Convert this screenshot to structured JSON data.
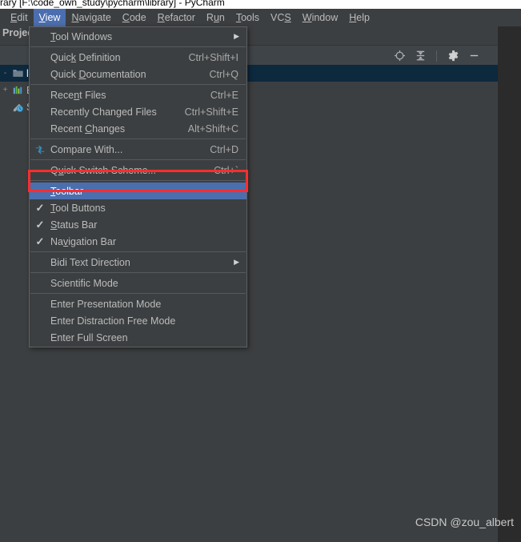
{
  "window": {
    "title": "rary [F:\\code_own_study\\pycharm\\library] - PyCharm"
  },
  "menubar": {
    "items": [
      {
        "label": "Edit",
        "mnemonic": "E",
        "selected": false
      },
      {
        "label": "View",
        "mnemonic": "V",
        "selected": true
      },
      {
        "label": "Navigate",
        "mnemonic": "N",
        "selected": false
      },
      {
        "label": "Code",
        "mnemonic": "C",
        "selected": false
      },
      {
        "label": "Refactor",
        "mnemonic": "R",
        "selected": false
      },
      {
        "label": "Run",
        "mnemonic": "u",
        "selected": false
      },
      {
        "label": "Tools",
        "mnemonic": "T",
        "selected": false
      },
      {
        "label": "VCS",
        "mnemonic": "S",
        "selected": false
      },
      {
        "label": "Window",
        "mnemonic": "W",
        "selected": false
      },
      {
        "label": "Help",
        "mnemonic": "H",
        "selected": false
      }
    ]
  },
  "project_panel": {
    "title": "Project",
    "toolbar": {
      "buttons": [
        {
          "icon": "locate-target-icon",
          "name": "select-opened-file-button"
        },
        {
          "icon": "collapse-all-icon",
          "name": "collapse-all-button"
        },
        {
          "icon": "gear-icon",
          "name": "settings-button"
        },
        {
          "icon": "minimize-icon",
          "name": "hide-button"
        }
      ]
    },
    "tree": [
      {
        "toggle": "-",
        "icon": "folder-icon",
        "label": "library",
        "selected": true
      },
      {
        "toggle": "+",
        "icon": "bar-chart-icon",
        "label": "External Libraries",
        "selected": false
      },
      {
        "toggle": "",
        "icon": "scratch-icon",
        "label": "Scratches and Consoles",
        "selected": false
      }
    ]
  },
  "view_menu": {
    "groups": [
      {
        "items": [
          {
            "label": "Tool Windows",
            "mnemonic": "T",
            "accel": "",
            "submenu": true,
            "check": false,
            "icon": ""
          }
        ]
      },
      {
        "items": [
          {
            "label": "Quick Definition",
            "mnemonic": "k",
            "accel": "Ctrl+Shift+I",
            "submenu": false,
            "check": false,
            "icon": ""
          },
          {
            "label": "Quick Documentation",
            "mnemonic": "D",
            "accel": "Ctrl+Q",
            "submenu": false,
            "check": false,
            "icon": ""
          }
        ]
      },
      {
        "items": [
          {
            "label": "Recent Files",
            "mnemonic": "n",
            "accel": "Ctrl+E",
            "submenu": false,
            "check": false,
            "icon": ""
          },
          {
            "label": "Recently Changed Files",
            "mnemonic": "",
            "accel": "Ctrl+Shift+E",
            "submenu": false,
            "check": false,
            "icon": ""
          },
          {
            "label": "Recent Changes",
            "mnemonic": "C",
            "accel": "Alt+Shift+C",
            "submenu": false,
            "check": false,
            "icon": ""
          }
        ]
      },
      {
        "items": [
          {
            "label": "Compare With...",
            "mnemonic": "",
            "accel": "Ctrl+D",
            "submenu": false,
            "check": false,
            "icon": "compare-icon"
          }
        ]
      },
      {
        "items": [
          {
            "label": "Quick Switch Scheme...",
            "mnemonic": "u",
            "accel": "Ctrl+`",
            "submenu": false,
            "check": false,
            "icon": ""
          }
        ]
      },
      {
        "items": [
          {
            "label": "Toolbar",
            "mnemonic": "T",
            "accel": "",
            "submenu": false,
            "check": false,
            "icon": "",
            "highlight": true
          },
          {
            "label": "Tool Buttons",
            "mnemonic": "T",
            "accel": "",
            "submenu": false,
            "check": true,
            "icon": ""
          },
          {
            "label": "Status Bar",
            "mnemonic": "S",
            "accel": "",
            "submenu": false,
            "check": true,
            "icon": ""
          },
          {
            "label": "Navigation Bar",
            "mnemonic": "v",
            "accel": "",
            "submenu": false,
            "check": true,
            "icon": ""
          }
        ]
      },
      {
        "items": [
          {
            "label": "Bidi Text Direction",
            "mnemonic": "",
            "accel": "",
            "submenu": true,
            "check": false,
            "icon": ""
          }
        ]
      },
      {
        "items": [
          {
            "label": "Scientific Mode",
            "mnemonic": "",
            "accel": "",
            "submenu": false,
            "check": false,
            "icon": ""
          }
        ]
      },
      {
        "items": [
          {
            "label": "Enter Presentation Mode",
            "mnemonic": "",
            "accel": "",
            "submenu": false,
            "check": false,
            "icon": ""
          },
          {
            "label": "Enter Distraction Free Mode",
            "mnemonic": "",
            "accel": "",
            "submenu": false,
            "check": false,
            "icon": ""
          },
          {
            "label": "Enter Full Screen",
            "mnemonic": "",
            "accel": "",
            "submenu": false,
            "check": false,
            "icon": ""
          }
        ]
      }
    ]
  },
  "annotation": {
    "highlight_color": "#ff2d2d",
    "target": "Toolbar"
  },
  "watermark": {
    "text": "CSDN @zou_albert"
  },
  "colors": {
    "background": "#3c3f41",
    "menu_highlight": "#4b6eaf",
    "tree_selection": "#0d293e",
    "gutter": "#2b2b2b"
  }
}
